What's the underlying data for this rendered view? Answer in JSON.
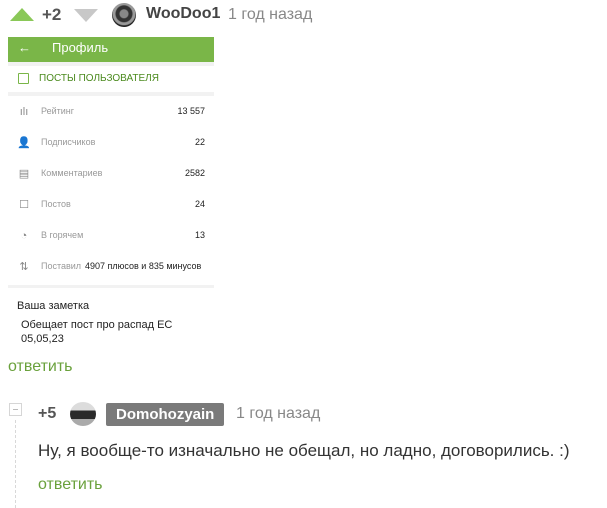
{
  "comment1": {
    "rating": "+2",
    "username": "WooDoo1",
    "time": "1 год назад",
    "reply": "ответить",
    "upvote_icon": "upvote-arrow",
    "downvote_icon": "downvote-arrow",
    "accent_color": "#8ac858",
    "screenshot": {
      "back_glyph": "←",
      "title": "Профиль",
      "posts_link": "ПОСТЫ ПОЛЬЗОВАТЕЛЯ",
      "stats": [
        {
          "icon": "rating-bars-icon",
          "glyph": "ılı",
          "label": "Рейтинг",
          "value": "13 557"
        },
        {
          "icon": "user-icon",
          "glyph": "👤",
          "label": "Подписчиков",
          "value": "22"
        },
        {
          "icon": "comment-icon",
          "glyph": "▤",
          "label": "Комментариев",
          "value": "2582"
        },
        {
          "icon": "post-icon",
          "glyph": "☐",
          "label": "Постов",
          "value": "24"
        },
        {
          "icon": "fire-icon",
          "glyph": "◔",
          "label": "В горячем",
          "value": "13"
        },
        {
          "icon": "updown-arrows-icon",
          "glyph": "⇅",
          "label": "Поставил",
          "value": "4907 плюсов и 835 минусов"
        }
      ],
      "note_title": "Ваша заметка",
      "note_text": "Обещает пост про распад ЕС 05,05,23"
    }
  },
  "comment2": {
    "rating": "+5",
    "username": "Domohozyain",
    "time": "1 год назад",
    "text": "Ну, я вообще-то изначально не обещал, но ладно, договорились. :)",
    "reply": "ответить"
  }
}
